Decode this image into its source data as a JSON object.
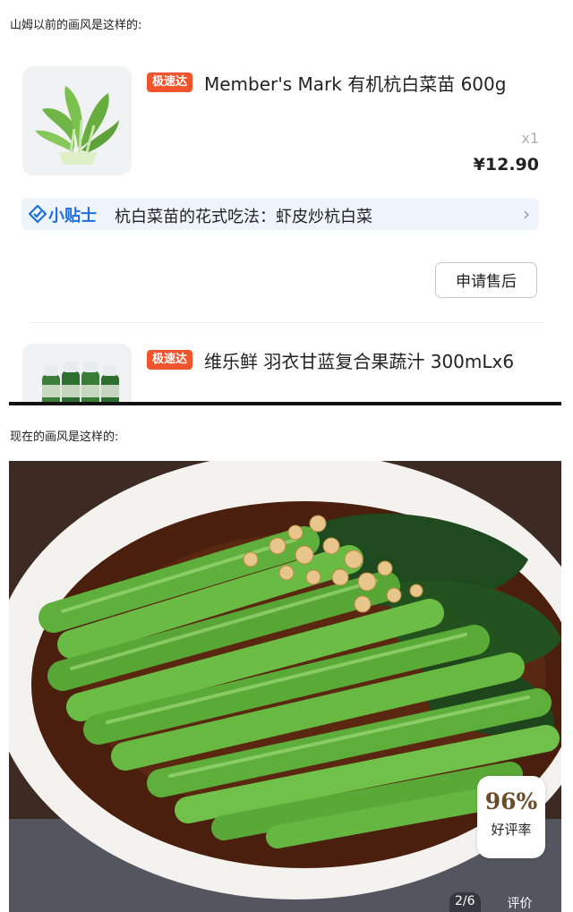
{
  "captions": {
    "before": "山姆以前的画风是这样的:",
    "after": "现在的画风是这样的:"
  },
  "order_items": [
    {
      "badge": "极速达",
      "name": "Member's Mark 有机杭白菜苗 600g",
      "quantity": "x1",
      "price": "¥12.90",
      "thumbnail_icon": "bok-choy-image"
    },
    {
      "badge": "极速达",
      "name": "维乐鲜 羽衣甘蓝复合果蔬汁 300mLx6",
      "thumbnail_icon": "juice-bottles-image"
    }
  ],
  "tip": {
    "icon": "tip-diamond-icon",
    "label": "小贴士",
    "text": "杭白菜苗的花式吃法：虾皮炒杭白菜",
    "chevron": "›"
  },
  "after_sale_button": "申请售后",
  "photo": {
    "subject": "greens-with-garlic-photo",
    "rating_value": "96%",
    "rating_label": "好评率",
    "page_indicator": "2/6",
    "review_tab": "评价"
  },
  "colors": {
    "badge": "#f0542d",
    "tip_accent": "#1f6fe0",
    "tip_bg": "#eef5fd",
    "rating_value": "#6b4a2a"
  }
}
